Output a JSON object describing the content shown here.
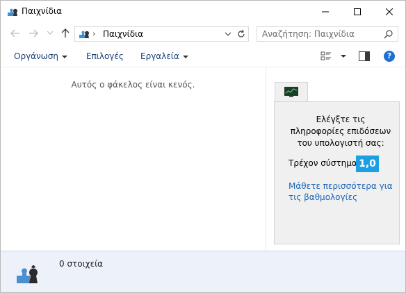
{
  "window": {
    "title": "Παιχνίδια",
    "icon": "games-folder-icon"
  },
  "nav": {
    "address_label": "Παιχνίδια",
    "address_separator": "›",
    "search_placeholder": "Αναζήτηση: Παιχνίδια"
  },
  "commands": {
    "organize": "Οργάνωση",
    "options": "Επιλογές",
    "tools": "Εργαλεία"
  },
  "content": {
    "empty_message": "Αυτός ο φάκελος είναι κενός."
  },
  "panel": {
    "description": "Ελέγξτε τις πληροφορίες επιδόσεων του υπολογιστή σας:",
    "score_label": "Τρέχον σύστημα",
    "score_value": "1,0",
    "learn_more": "Μάθετε περισσότερα για τις βαθμολογίες",
    "accent_color": "#1d9fe3"
  },
  "details": {
    "item_count": "0 στοιχεία"
  }
}
